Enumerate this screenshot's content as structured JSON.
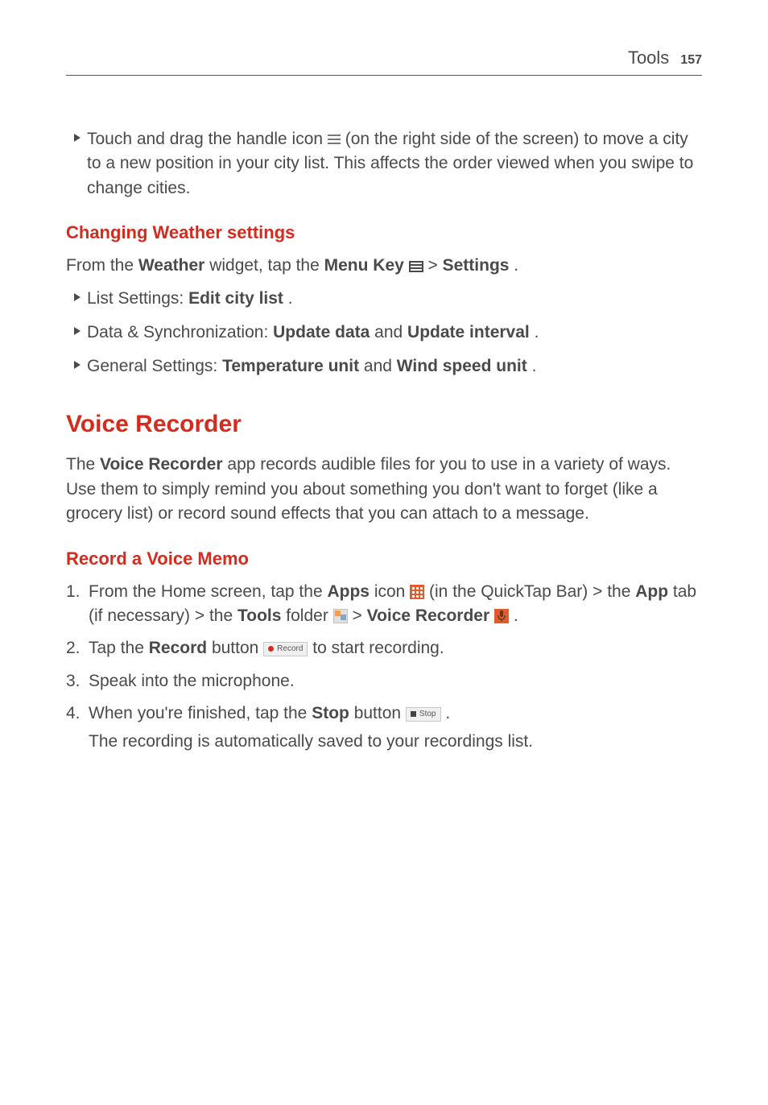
{
  "header": {
    "section": "Tools",
    "page_num": "157"
  },
  "bullet_drag": {
    "t1": "Touch and drag the handle icon ",
    "t2": " (on the right side of the screen) to move a city to a new position in your city list. This affects the order viewed when you swipe to change cities."
  },
  "weather_heading": "Changing Weather settings",
  "weather_intro": {
    "t1": "From the ",
    "b1": "Weather",
    "t2": " widget, tap the ",
    "b2": "Menu Key ",
    "t3": " > ",
    "b3": "Settings",
    "t4": "."
  },
  "list_settings": {
    "label": "List Settings: ",
    "bold": "Edit city list",
    "tail": "."
  },
  "data_sync": {
    "label": "Data & Synchronization: ",
    "b1": "Update data",
    "mid": " and ",
    "b2": "Update interval",
    "tail": "."
  },
  "general_settings": {
    "label": "General Settings: ",
    "b1": "Temperature unit",
    "mid": " and ",
    "b2": "Wind speed unit",
    "tail": "."
  },
  "voice_heading": "Voice Recorder",
  "voice_intro": {
    "t1": "The ",
    "b1": "Voice Recorder",
    "t2": " app records audible files for you to use in a variety of ways. Use them to simply remind you about something you don't want to forget (like a grocery list) or record sound effects that you can attach to a message."
  },
  "memo_heading": "Record a Voice Memo",
  "step1": {
    "num": "1.",
    "t1": "From the Home screen, tap the ",
    "b1": "Apps",
    "t2": " icon ",
    "t3": " (in the QuickTap Bar) > the ",
    "b2": "App",
    "t4": " tab (if necessary) > the ",
    "b3": "Tools",
    "t5": " folder ",
    "t6": " > ",
    "b4": "Voice Recorder ",
    "t7": "."
  },
  "step2": {
    "num": "2.",
    "t1": "Tap the ",
    "b1": "Record",
    "t2": " button ",
    "btn_label": "Record",
    "t3": " to start recording."
  },
  "step3": {
    "num": "3.",
    "t1": "Speak into the microphone."
  },
  "step4": {
    "num": "4.",
    "t1": "When you're finished, tap the ",
    "b1": "Stop",
    "t2": " button ",
    "btn_label": "Stop",
    "t3": ".",
    "line2": "The recording is automatically saved to your recordings list."
  }
}
